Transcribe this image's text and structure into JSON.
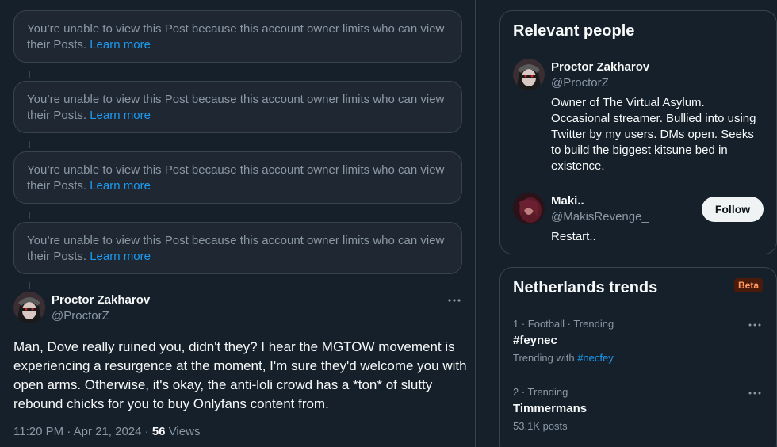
{
  "restricted_posts": [
    {
      "message": "You’re unable to view this Post because this account owner limits who can view their Posts.",
      "link": "Learn more"
    },
    {
      "message": "You’re unable to view this Post because this account owner limits who can view their Posts.",
      "link": "Learn more"
    },
    {
      "message": "You’re unable to view this Post because this account owner limits who can view their Posts.",
      "link": "Learn more"
    },
    {
      "message": "You’re unable to view this Post because this account owner limits who can view their Posts.",
      "link": "Learn more"
    }
  ],
  "tweet": {
    "author_name": "Proctor Zakharov",
    "author_handle": "@ProctorZ",
    "more_icon": "more-horizontal-icon",
    "text": "Man, Dove really ruined you, didn't they? I hear the MGTOW movement is experiencing a resurgence at the moment, I'm sure they'd welcome you with open arms. Otherwise, it's okay, the anti-loli crowd has a *ton* of slutty rebound chicks for you to buy Onlyfans content from.",
    "timestamp": "11:20 PM · Apr 21, 2024",
    "separator": "·",
    "views_count": "56",
    "views_label": "Views"
  },
  "relevant_people": {
    "title": "Relevant people",
    "people": [
      {
        "name": "Proctor Zakharov",
        "handle": "@ProctorZ",
        "bio": "Owner of The Virtual Asylum. Occasional streamer. Bullied into using Twitter by my users. DMs open. Seeks to build the biggest kitsune bed in existence."
      },
      {
        "name": "Maki..",
        "handle": "@MakisRevenge_",
        "bio": "Restart..",
        "follow_label": "Follow"
      }
    ]
  },
  "trends": {
    "title": "Netherlands trends",
    "badge": "Beta",
    "items": [
      {
        "meta": "1 · Football · Trending",
        "name": "#feynec",
        "sub_prefix": "Trending with",
        "sub_link": "#necfey"
      },
      {
        "meta": "2 · Trending",
        "name": "Timmermans",
        "sub": "53.1K posts"
      }
    ]
  },
  "colors": {
    "background": "#15202b",
    "accent": "#1d9bf0",
    "muted_text": "#8b98a5",
    "border": "#38444d"
  }
}
